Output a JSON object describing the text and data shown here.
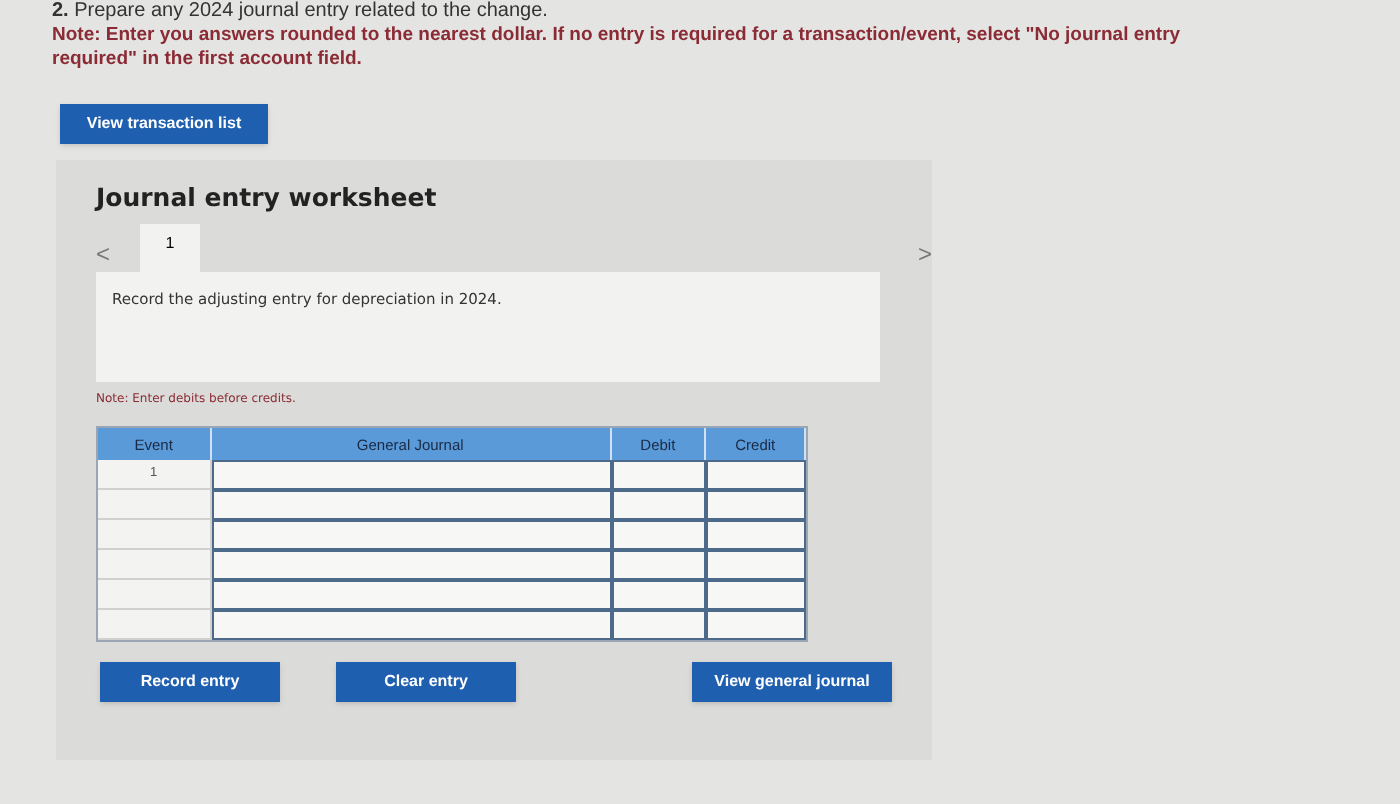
{
  "question": "**2.** Prepare any 2024 journal entry related to the change.",
  "note": "Note: Enter you answers rounded to the nearest dollar. If no entry is required for a transaction/event, select \"No journal entry required\" in the first account field.",
  "transaction_button": "View transaction list",
  "worksheet": {
    "title": "Journal entry worksheet",
    "prev": "<",
    "next": ">",
    "tabs": [
      {
        "label": "1",
        "selected": true
      }
    ],
    "instruction": "Record the adjusting entry for depreciation in 2024.",
    "note": "Note: Enter debits before credits.",
    "table": {
      "columns": [
        "Event",
        "General Journal",
        "Debit",
        "Credit"
      ],
      "rows": [
        {
          "event": "1"
        },
        {},
        {},
        {},
        {},
        {}
      ]
    },
    "buttons": [
      "Record entry",
      "Clear entry",
      "View general journal"
    ]
  }
}
